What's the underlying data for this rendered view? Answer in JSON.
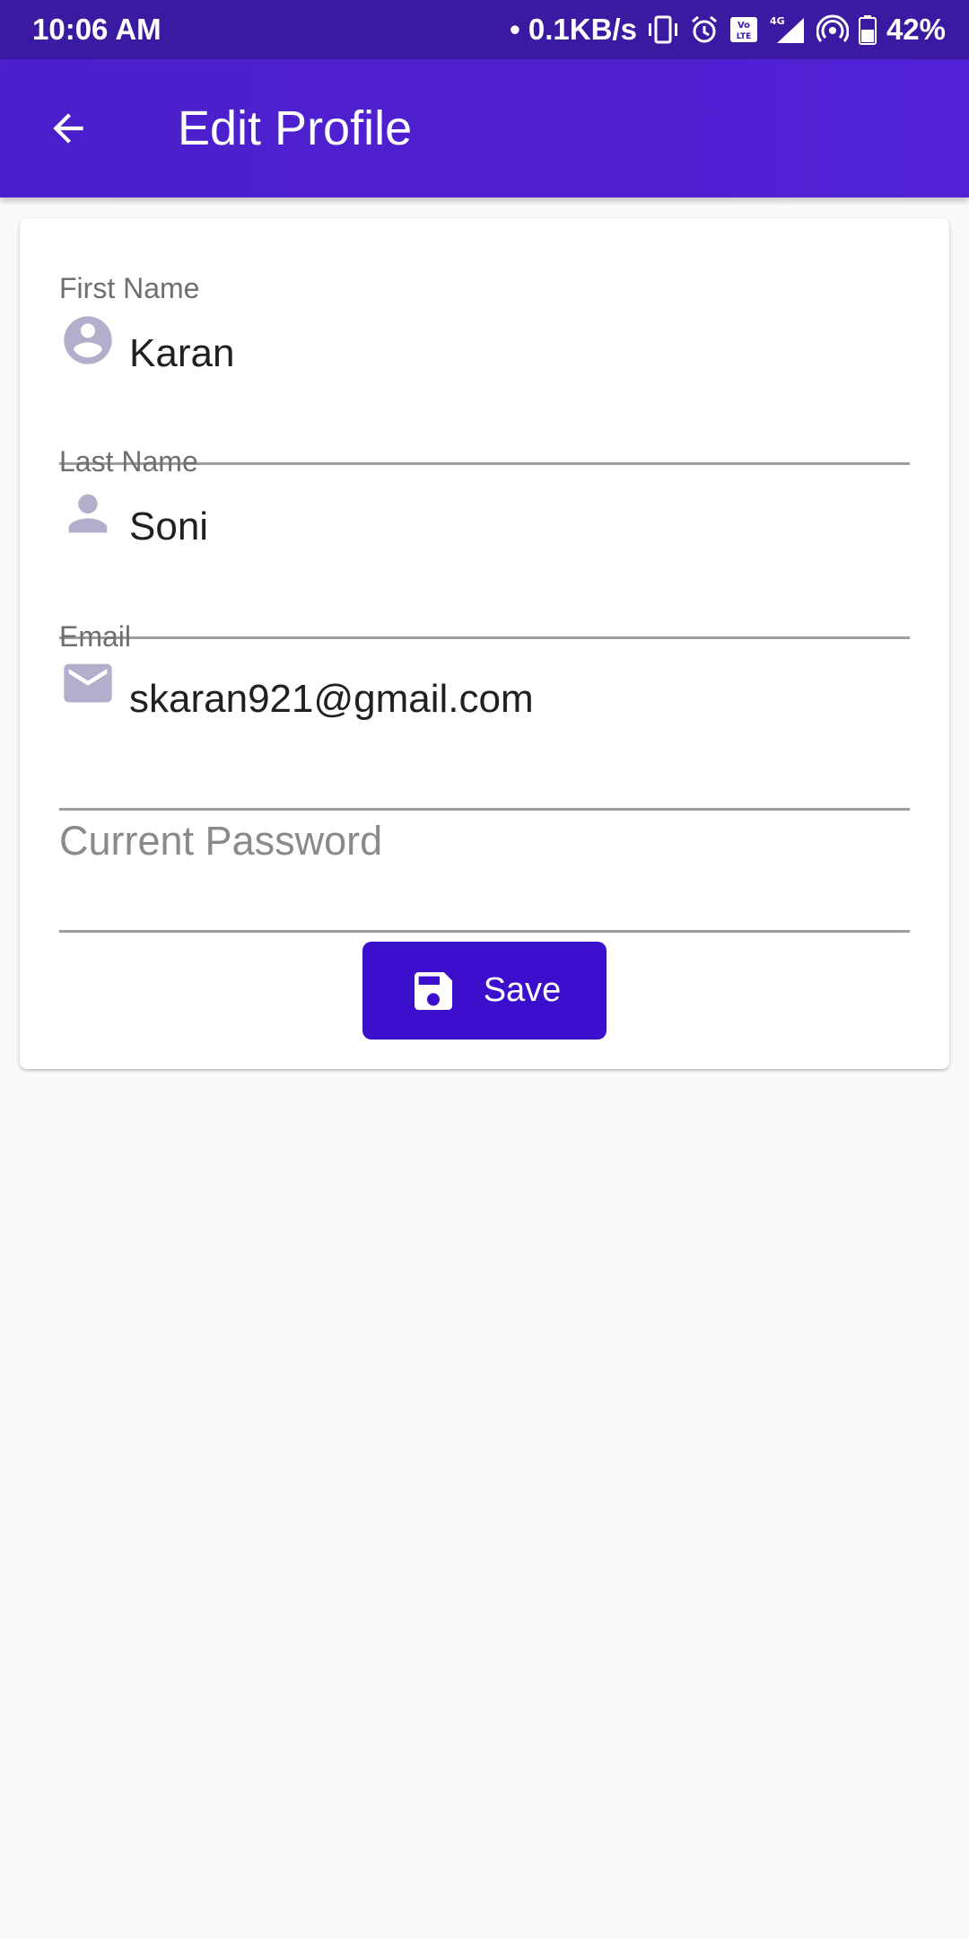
{
  "status_bar": {
    "time": "10:06 AM",
    "network_speed": "• 0.1KB/s",
    "battery": "42%",
    "icons": [
      "vibrate-icon",
      "alarm-icon",
      "volte-icon",
      "signal-4g-icon",
      "hotspot-icon",
      "battery-icon"
    ]
  },
  "app_bar": {
    "title": "Edit Profile",
    "back_icon": "arrow-left-icon"
  },
  "form": {
    "first_name": {
      "label": "First Name",
      "value": "Karan",
      "icon": "account-circle-icon"
    },
    "last_name": {
      "label": "Last Name",
      "value": "Soni",
      "icon": "person-icon"
    },
    "email": {
      "label": "Email",
      "value": "skaran921@gmail.com",
      "icon": "email-icon"
    },
    "current_password": {
      "placeholder": "Current Password",
      "value": ""
    },
    "save_button": {
      "label": "Save",
      "icon": "save-icon"
    }
  },
  "colors": {
    "status_bar": "#3a1aa0",
    "app_bar": "#4c1fcc",
    "button": "#3b0fcc",
    "icon": "#b3aecb",
    "background": "#fafafa"
  }
}
